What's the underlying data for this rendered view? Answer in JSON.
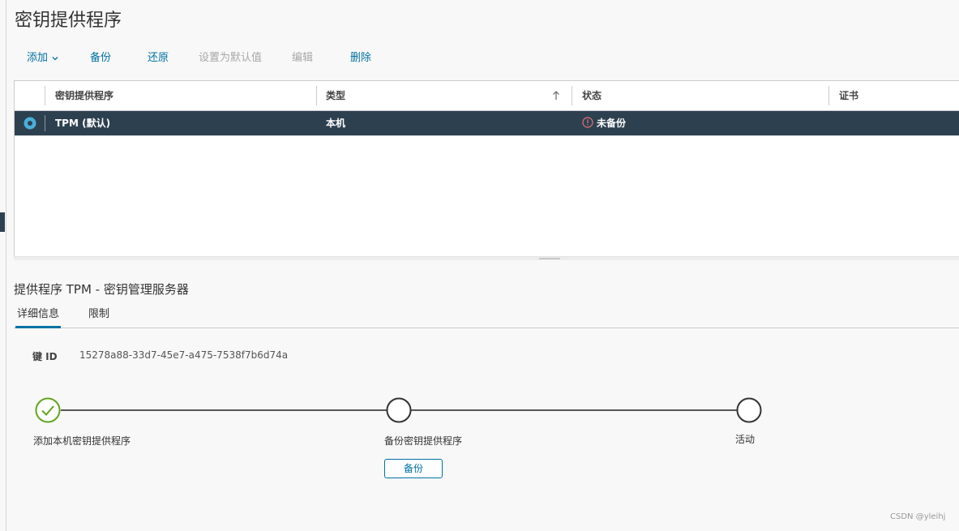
{
  "page": {
    "title": "密钥提供程序"
  },
  "toolbar": {
    "add_label": "添加",
    "backup_label": "备份",
    "restore_label": "还原",
    "set_default_label": "设置为默认值",
    "edit_label": "编辑",
    "delete_label": "删除"
  },
  "grid": {
    "columns": [
      "密钥提供程序",
      "类型",
      "状态",
      "证书"
    ],
    "rows": [
      {
        "provider": "TPM (默认)",
        "type": "本机",
        "status": "未备份",
        "certificate": "",
        "selected": true
      }
    ]
  },
  "details": {
    "title": "提供程序 TPM - 密钥管理服务器",
    "tabs": [
      {
        "label": "详细信息",
        "active": true
      },
      {
        "label": "限制",
        "active": false
      }
    ],
    "key_id_label": "键 ID",
    "key_id_value": "15278a88-33d7-45e7-a475-7538f7b6d74a",
    "steps": [
      {
        "label": "添加本机密钥提供程序",
        "state": "done"
      },
      {
        "label": "备份密钥提供程序",
        "state": "pending"
      },
      {
        "label": "活动",
        "state": "pending"
      }
    ],
    "backup_button_label": "备份"
  },
  "watermark": "CSDN @yleihj",
  "icons": {
    "add_dropdown": "chevron-down-icon",
    "sort": "arrow-up-icon",
    "status_warning": "exclamation-circle-icon",
    "step_done": "check-circle-icon",
    "step_pending": "circle-icon",
    "row_select": "radio-icon"
  },
  "colors": {
    "accent": "#0072a3",
    "selected_row": "#2d4050",
    "step_done": "#62a420",
    "warning": "#e57373",
    "disabled": "#a8a8a8"
  }
}
